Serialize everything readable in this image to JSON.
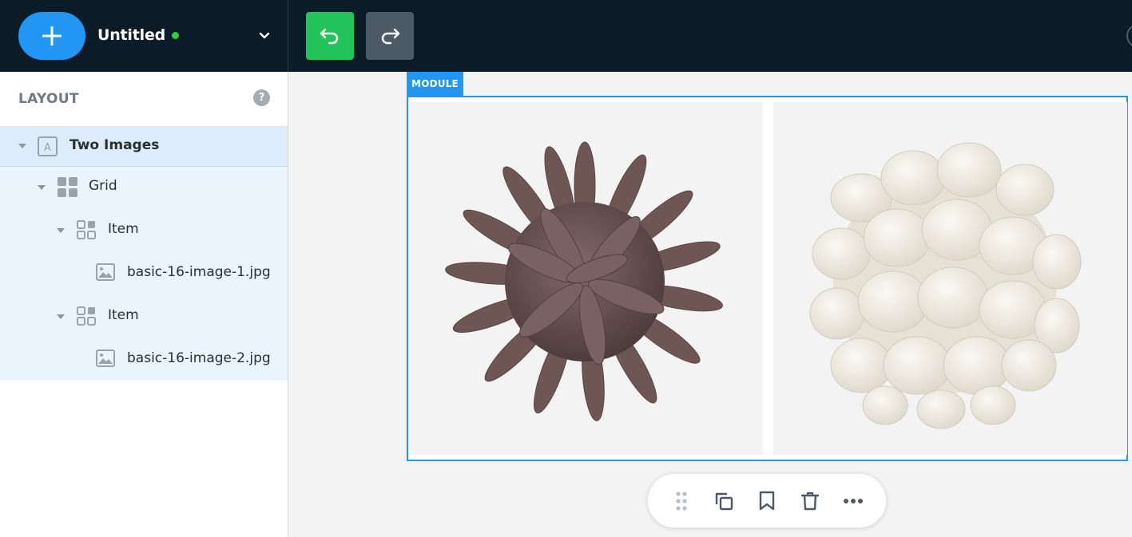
{
  "header": {
    "document_title": "Untitled",
    "status_color": "#2ecc40",
    "add_icon": "plus-icon",
    "undo_icon": "undo-icon",
    "redo_icon": "redo-icon"
  },
  "sidebar": {
    "title": "LAYOUT",
    "help_label": "?",
    "tree": [
      {
        "label": "Two Images",
        "icon": "module-a-icon",
        "level": 0,
        "expanded": true,
        "selected": true
      },
      {
        "label": "Grid",
        "icon": "grid-icon",
        "level": 1,
        "expanded": true
      },
      {
        "label": "Item",
        "icon": "item-grid-icon",
        "level": 2,
        "expanded": true
      },
      {
        "label": "basic-16-image-1.jpg",
        "icon": "image-icon",
        "level": 3
      },
      {
        "label": "Item",
        "icon": "item-grid-icon",
        "level": 2,
        "expanded": true
      },
      {
        "label": "basic-16-image-2.jpg",
        "icon": "image-icon",
        "level": 3
      }
    ]
  },
  "canvas": {
    "module_tag": "MODULE",
    "images": [
      {
        "description": "brown spiky 3D sphere",
        "color": "#6b5453"
      },
      {
        "description": "white bumpy 3D sphere",
        "color": "#efeadf"
      }
    ]
  },
  "toolbar": {
    "tools": [
      "drag-handle-icon",
      "duplicate-icon",
      "bookmark-icon",
      "trash-icon",
      "more-icon"
    ]
  },
  "colors": {
    "accent": "#2196f3",
    "topbar": "#0b1c28",
    "undo": "#24c25a",
    "redo": "#4b5a66"
  }
}
